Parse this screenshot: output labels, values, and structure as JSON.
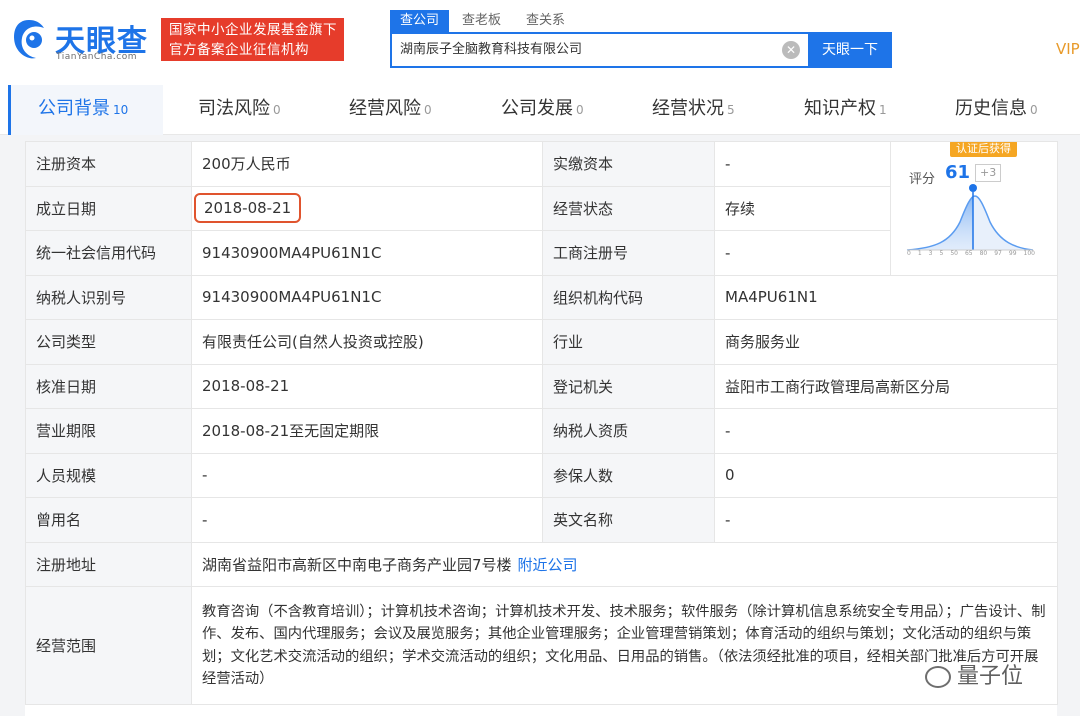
{
  "header": {
    "logo_name": "天眼查",
    "logo_url": "TianYanCha.com",
    "badge_line1": "国家中小企业发展基金旗下",
    "badge_line2": "官方备案企业征信机构",
    "search_tabs": [
      "查公司",
      "查老板",
      "查关系"
    ],
    "search_value": "湖南辰子全脑教育科技有限公司",
    "search_button": "天眼一下",
    "vip": "VIP"
  },
  "tabs": [
    {
      "label": "公司背景",
      "count": "10"
    },
    {
      "label": "司法风险",
      "count": "0"
    },
    {
      "label": "经营风险",
      "count": "0"
    },
    {
      "label": "公司发展",
      "count": "0"
    },
    {
      "label": "经营状况",
      "count": "5"
    },
    {
      "label": "知识产权",
      "count": "1"
    },
    {
      "label": "历史信息",
      "count": "0"
    }
  ],
  "info": {
    "reg_capital_label": "注册资本",
    "reg_capital": "200万人民币",
    "paid_capital_label": "实缴资本",
    "paid_capital": "-",
    "found_date_label": "成立日期",
    "found_date": "2018-08-21",
    "status_label": "经营状态",
    "status": "存续",
    "credit_code_label": "统一社会信用代码",
    "credit_code": "91430900MA4PU61N1C",
    "biz_reg_label": "工商注册号",
    "biz_reg": "-",
    "taxpayer_id_label": "纳税人识别号",
    "taxpayer_id": "91430900MA4PU61N1C",
    "org_code_label": "组织机构代码",
    "org_code": "MA4PU61N1",
    "company_type_label": "公司类型",
    "company_type": "有限责任公司(自然人投资或控股)",
    "industry_label": "行业",
    "industry": "商务服务业",
    "approve_date_label": "核准日期",
    "approve_date": "2018-08-21",
    "reg_authority_label": "登记机关",
    "reg_authority": "益阳市工商行政管理局高新区分局",
    "biz_term_label": "营业期限",
    "biz_term": "2018-08-21至无固定期限",
    "taxpayer_qual_label": "纳税人资质",
    "taxpayer_qual": "-",
    "staff_size_label": "人员规模",
    "staff_size": "-",
    "insured_label": "参保人数",
    "insured": "0",
    "former_name_label": "曾用名",
    "former_name": "-",
    "english_name_label": "英文名称",
    "english_name": "-",
    "address_label": "注册地址",
    "address": "湖南省益阳市高新区中南电子商务产业园7号楼",
    "nearby_link": "附近公司",
    "scope_label": "经营范围",
    "scope": "教育咨询（不含教育培训）；计算机技术咨询；计算机技术开发、技术服务；软件服务（除计算机信息系统安全专用品）；广告设计、制作、发布、国内代理服务；会议及展览服务；其他企业管理服务；企业管理营销策划；体育活动的组织与策划；文化活动的组织与策划；文化艺术交流活动的组织；学术交流活动的组织；文化用品、日用品的销售。（依法须经批准的项目，经相关部门批准后方可开展经营活动）"
  },
  "score": {
    "badge": "认证后获得",
    "label": "评分",
    "value": "61",
    "delta": "+3",
    "axis_ticks": [
      "0",
      "1",
      "3",
      "5",
      "50",
      "65",
      "80",
      "97",
      "99",
      "100"
    ]
  },
  "watermark": "量子位",
  "colors": {
    "brand": "#1e74e8",
    "badge_red": "#e63c2b",
    "highlight": "#e0542e",
    "score_badge": "#f5a623"
  }
}
